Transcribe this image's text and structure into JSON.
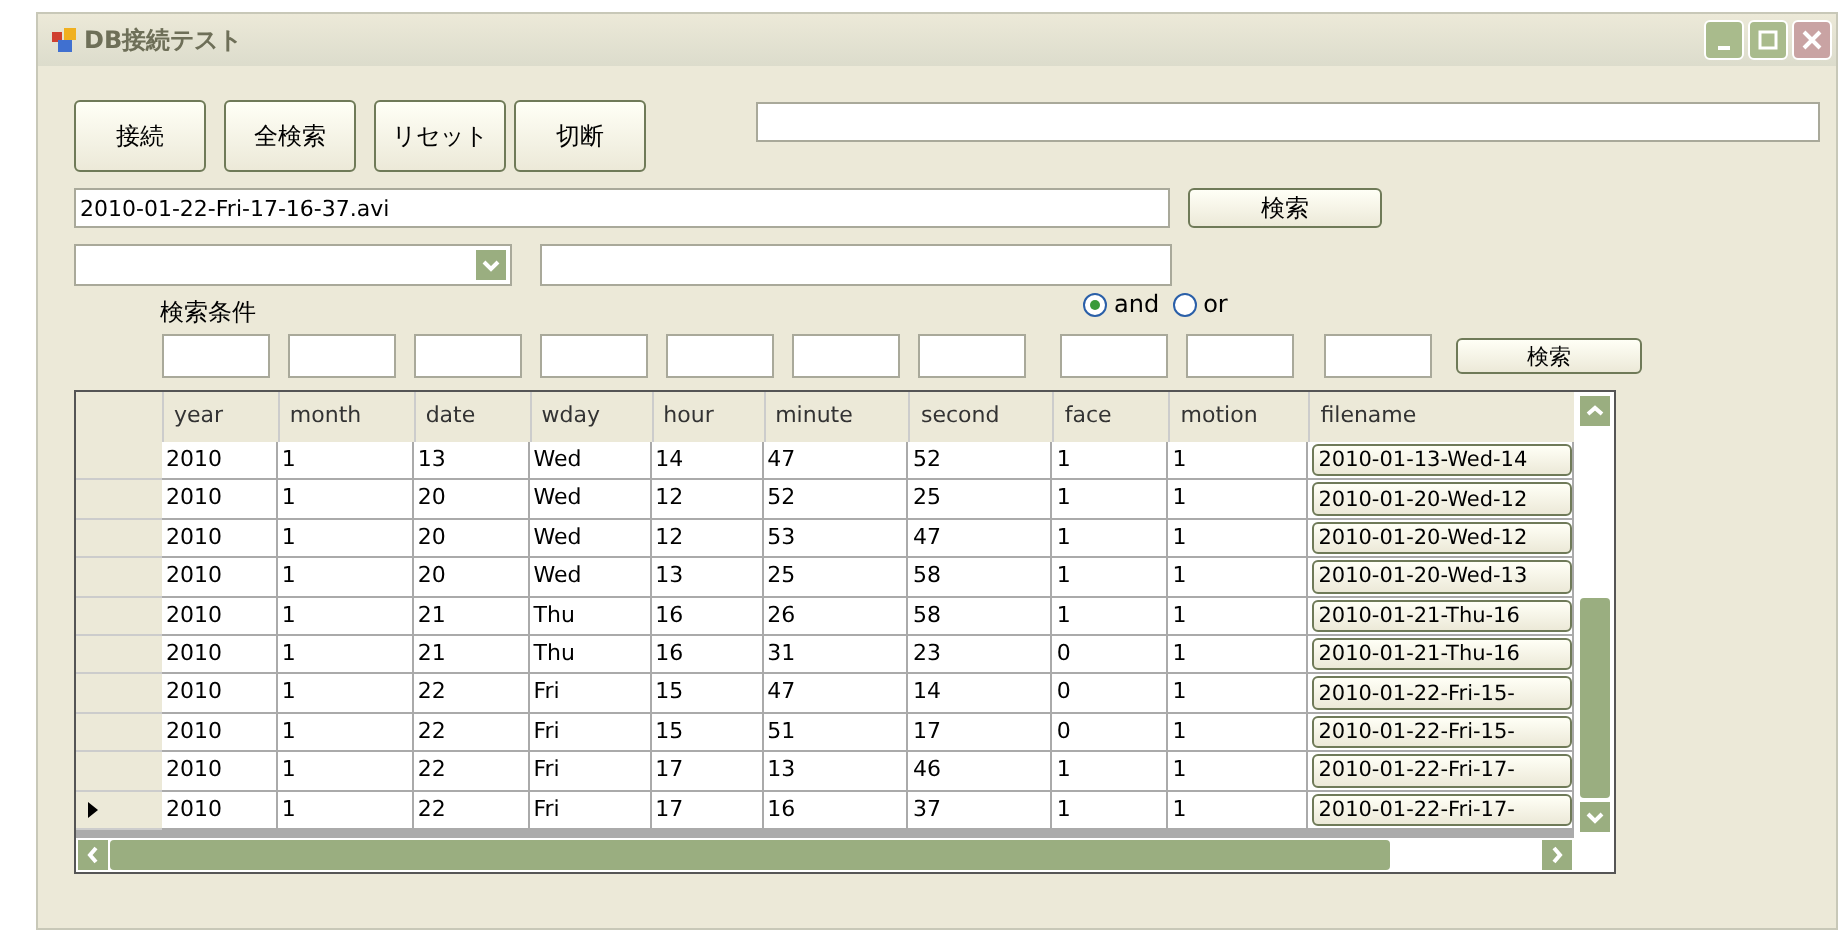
{
  "window": {
    "title": "DB接続テスト"
  },
  "buttons": [
    "接続",
    "全検索",
    "リセット",
    "切断"
  ],
  "filename_field": {
    "value": "2010-01-22-Fri-17-16-37.avi"
  },
  "search_button": "検索",
  "criteria_label": "検索条件",
  "radios": [
    {
      "label": "and",
      "selected": true
    },
    {
      "label": "or",
      "selected": false
    }
  ],
  "criteria_search_button": "検索",
  "table": {
    "columns": [
      "year",
      "month",
      "date",
      "wday",
      "hour",
      "minute",
      "second",
      "face",
      "motion",
      "filename"
    ],
    "rows": [
      {
        "current": false,
        "cells": [
          "2010",
          "1",
          "13",
          "Wed",
          "14",
          "47",
          "52",
          "1",
          "1",
          "2010-01-13-Wed-14"
        ]
      },
      {
        "current": false,
        "cells": [
          "2010",
          "1",
          "20",
          "Wed",
          "12",
          "52",
          "25",
          "1",
          "1",
          "2010-01-20-Wed-12"
        ]
      },
      {
        "current": false,
        "cells": [
          "2010",
          "1",
          "20",
          "Wed",
          "12",
          "53",
          "47",
          "1",
          "1",
          "2010-01-20-Wed-12"
        ]
      },
      {
        "current": false,
        "cells": [
          "2010",
          "1",
          "20",
          "Wed",
          "13",
          "25",
          "58",
          "1",
          "1",
          "2010-01-20-Wed-13"
        ]
      },
      {
        "current": false,
        "cells": [
          "2010",
          "1",
          "21",
          "Thu",
          "16",
          "26",
          "58",
          "1",
          "1",
          "2010-01-21-Thu-16"
        ]
      },
      {
        "current": false,
        "cells": [
          "2010",
          "1",
          "21",
          "Thu",
          "16",
          "31",
          "23",
          "0",
          "1",
          "2010-01-21-Thu-16"
        ]
      },
      {
        "current": false,
        "cells": [
          "2010",
          "1",
          "22",
          "Fri",
          "15",
          "47",
          "14",
          "0",
          "1",
          "2010-01-22-Fri-15-"
        ]
      },
      {
        "current": false,
        "cells": [
          "2010",
          "1",
          "22",
          "Fri",
          "15",
          "51",
          "17",
          "0",
          "1",
          "2010-01-22-Fri-15-"
        ]
      },
      {
        "current": false,
        "cells": [
          "2010",
          "1",
          "22",
          "Fri",
          "17",
          "13",
          "46",
          "1",
          "1",
          "2010-01-22-Fri-17-"
        ]
      },
      {
        "current": true,
        "cells": [
          "2010",
          "1",
          "22",
          "Fri",
          "17",
          "16",
          "37",
          "1",
          "1",
          "2010-01-22-Fri-17-"
        ]
      }
    ]
  }
}
